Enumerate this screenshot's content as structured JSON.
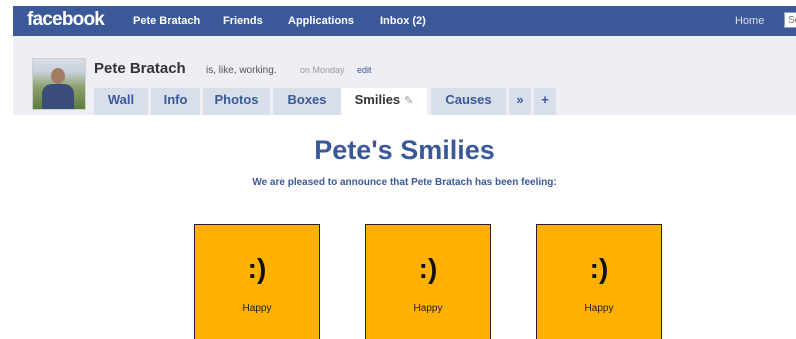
{
  "topbar": {
    "logo": "facebook",
    "nav": [
      "Pete Bratach",
      "Friends",
      "Applications",
      "Inbox (2)"
    ],
    "home": "Home",
    "search_value": "Se"
  },
  "profile": {
    "name": "Pete Bratach",
    "status": "is, like, working.",
    "status_time": "on Monday",
    "edit": "edit"
  },
  "tabs": [
    "Wall",
    "Info",
    "Photos",
    "Boxes",
    "Smilies",
    "Causes",
    "»",
    "+"
  ],
  "active_tab": "Smilies",
  "content": {
    "title": "Pete's Smilies",
    "announcement": "We are pleased to announce that Pete Bratach has been feeling:",
    "smilies": [
      {
        "face": ":)",
        "label": "Happy"
      },
      {
        "face": ":)",
        "label": "Happy"
      },
      {
        "face": ":)",
        "label": "Happy"
      }
    ]
  },
  "colors": {
    "brand_blue": "#3b5998",
    "header_gray": "#edeff4",
    "tab_bg": "#d8dfea",
    "smiley_box": "#ffb000"
  }
}
